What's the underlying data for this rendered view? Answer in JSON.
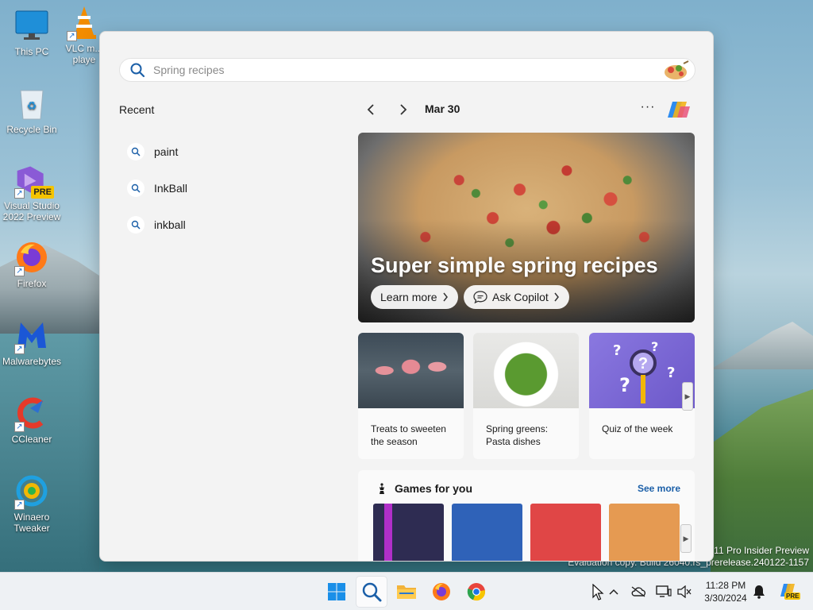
{
  "desktop": {
    "icons": [
      {
        "label": "This PC"
      },
      {
        "label": "VLC m... playe"
      },
      {
        "label": "Recycle Bin"
      },
      {
        "label": "Visual Studio 2022 Preview"
      },
      {
        "label": "Firefox"
      },
      {
        "label": "Malwarebytes"
      },
      {
        "label": "CCleaner"
      },
      {
        "label": "Winaero Tweaker"
      }
    ],
    "vs_badge": "PRE",
    "watermark_line1": "s 11 Pro Insider Preview",
    "watermark_line2": "Evaluation copy. Build 26040.rs_prerelease.240122-1157"
  },
  "search": {
    "placeholder": "Spring recipes",
    "value": ""
  },
  "recent": {
    "title": "Recent",
    "items": [
      {
        "label": "paint"
      },
      {
        "label": "InkBall"
      },
      {
        "label": "inkball"
      }
    ]
  },
  "highlights": {
    "date": "Mar 30",
    "more_label": "···",
    "hero": {
      "title": "Super simple spring recipes",
      "learn_more": "Learn more",
      "ask_copilot": "Ask Copilot"
    },
    "cards": [
      {
        "caption": "Treats to sweeten the season"
      },
      {
        "caption": "Spring greens: Pasta dishes"
      },
      {
        "caption": "Quiz of the week"
      }
    ],
    "games": {
      "title": "Games for you",
      "see_more": "See more",
      "tile_colors": [
        "#2e2c52",
        "#2f62b8",
        "#e04646",
        "#e59a52"
      ]
    }
  },
  "taskbar": {
    "time": "11:28 PM",
    "date": "3/30/2024",
    "tray_badge": "PRE"
  },
  "colors": {
    "accent": "#1b5fa8",
    "panel_bg": "#f3f3f3"
  }
}
